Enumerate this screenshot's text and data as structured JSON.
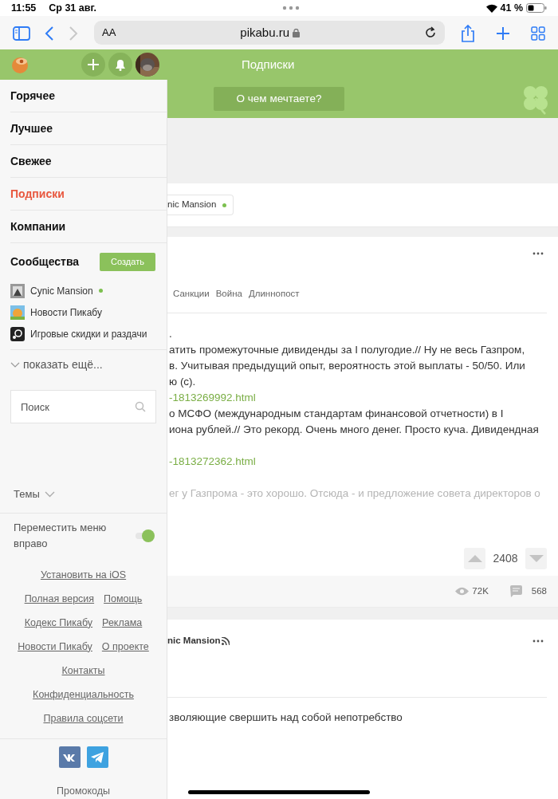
{
  "status_bar": {
    "time": "11:55",
    "date": "Ср 31 авг.",
    "battery": "41 %"
  },
  "browser": {
    "text_size": "AA",
    "url": "pikabu.ru",
    "forward_disabled": true
  },
  "header": {
    "title": "Подписки",
    "composer": "О чем мечтаете?"
  },
  "sidebar": {
    "nav": [
      {
        "label": "Горячее",
        "selected": false
      },
      {
        "label": "Лучшее",
        "selected": false
      },
      {
        "label": "Свежее",
        "selected": false
      },
      {
        "label": "Подписки",
        "selected": true
      },
      {
        "label": "Компании",
        "selected": false
      }
    ],
    "communities_title": "Сообщества",
    "create_button": "Создать",
    "communities": [
      {
        "name": "Cynic Mansion",
        "online": true
      },
      {
        "name": "Новости Пикабу",
        "online": false
      },
      {
        "name": "Игровые скидки и раздачи",
        "online": false
      }
    ],
    "show_more": "показать ещё...",
    "search": {
      "placeholder": "Поиск"
    },
    "themes": "Темы",
    "move_menu": {
      "label": "Переместить меню вправо",
      "on": true
    },
    "links": [
      [
        "Установить на iOS"
      ],
      [
        "Полная версия",
        "Помощь"
      ],
      [
        "Кодекс Пикабу",
        "Реклама"
      ],
      [
        "Новости Пикабу",
        "О проекте"
      ],
      [
        "Контакты"
      ],
      [
        "Конфиденциальность"
      ],
      [
        "Правила соцсети"
      ]
    ],
    "promo": "Промокоды"
  },
  "feed": {
    "filter_chip": {
      "label": "nic Mansion",
      "online": true
    },
    "posts": [
      {
        "tags": [
          "Санкции",
          "Война",
          "Длиннопост"
        ],
        "body": [
          {
            "kind": "text",
            "text": "."
          },
          {
            "kind": "text",
            "text": "атить промежуточные дивиденды за I полугодие.// Ну не весь Газпром,"
          },
          {
            "kind": "text",
            "text": "в. Учитывая предыдущий опыт, вероятность этой выплаты - 50/50. Или"
          },
          {
            "kind": "text",
            "text": "ю (с)."
          },
          {
            "kind": "link",
            "text": "-1813269992.html"
          },
          {
            "kind": "text",
            "text": "о МСФО (международным стандартам финансовой отчетности) в I"
          },
          {
            "kind": "text",
            "text": "иона рублей.// Это рекорд. Очень много денег. Просто куча. Дивидендная"
          },
          {
            "kind": "link",
            "text": "-1813272362.html",
            "space_before": true
          },
          {
            "kind": "faded",
            "text": "ег у Газпрома - это хорошо. Отсюда - и предложение совета директоров о",
            "space_before": true
          }
        ],
        "rating": "2408",
        "views": "72K",
        "comments": "568"
      },
      {
        "author": "nic Mansion",
        "subscribed": true,
        "body": [
          {
            "kind": "text",
            "text": "зволяющие свершить над собой непотребство"
          }
        ]
      }
    ]
  }
}
